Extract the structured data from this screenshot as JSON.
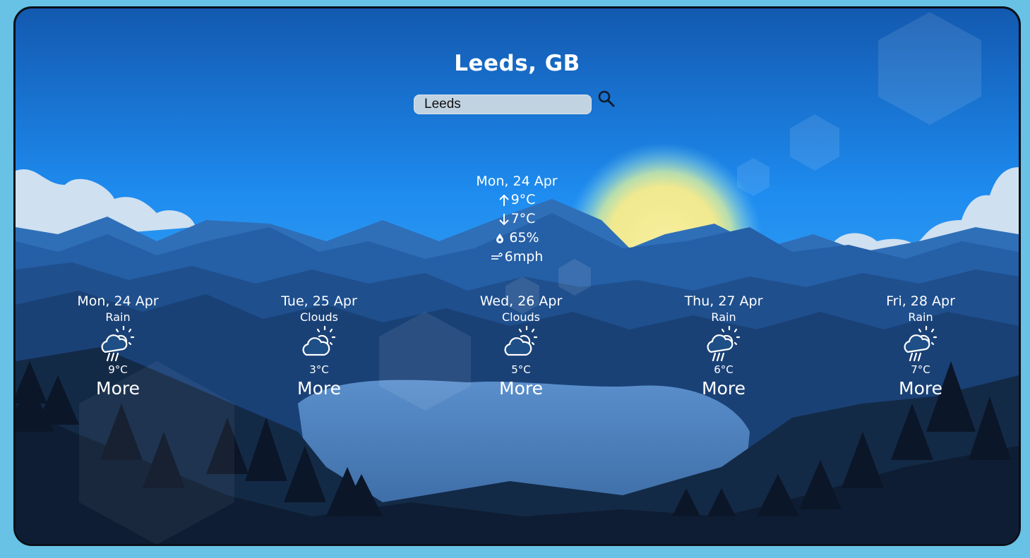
{
  "location": {
    "title": "Leeds, GB"
  },
  "search": {
    "value": "Leeds"
  },
  "current": {
    "date": "Mon, 24 Apr",
    "max_temp": "9°C",
    "min_temp": "7°C",
    "humidity": "65%",
    "wind": "6mph"
  },
  "forecast": [
    {
      "date": "Mon, 24 Apr",
      "condition": "Rain",
      "icon": "rain-sun-icon",
      "temp": "9°C",
      "more_label": "More"
    },
    {
      "date": "Tue, 25 Apr",
      "condition": "Clouds",
      "icon": "cloud-sun-icon",
      "temp": "3°C",
      "more_label": "More"
    },
    {
      "date": "Wed, 26 Apr",
      "condition": "Clouds",
      "icon": "cloud-sun-icon",
      "temp": "5°C",
      "more_label": "More"
    },
    {
      "date": "Thu, 27 Apr",
      "condition": "Rain",
      "icon": "rain-sun-icon",
      "temp": "6°C",
      "more_label": "More"
    },
    {
      "date": "Fri, 28 Apr",
      "condition": "Rain",
      "icon": "rain-sun-icon",
      "temp": "7°C",
      "more_label": "More"
    }
  ],
  "colors": {
    "page_background": "#67c2e6",
    "sky_top": "#1560b6",
    "sky_mid": "#1e8cf0",
    "sun": "#f2ec9a",
    "text": "#ffffff"
  }
}
